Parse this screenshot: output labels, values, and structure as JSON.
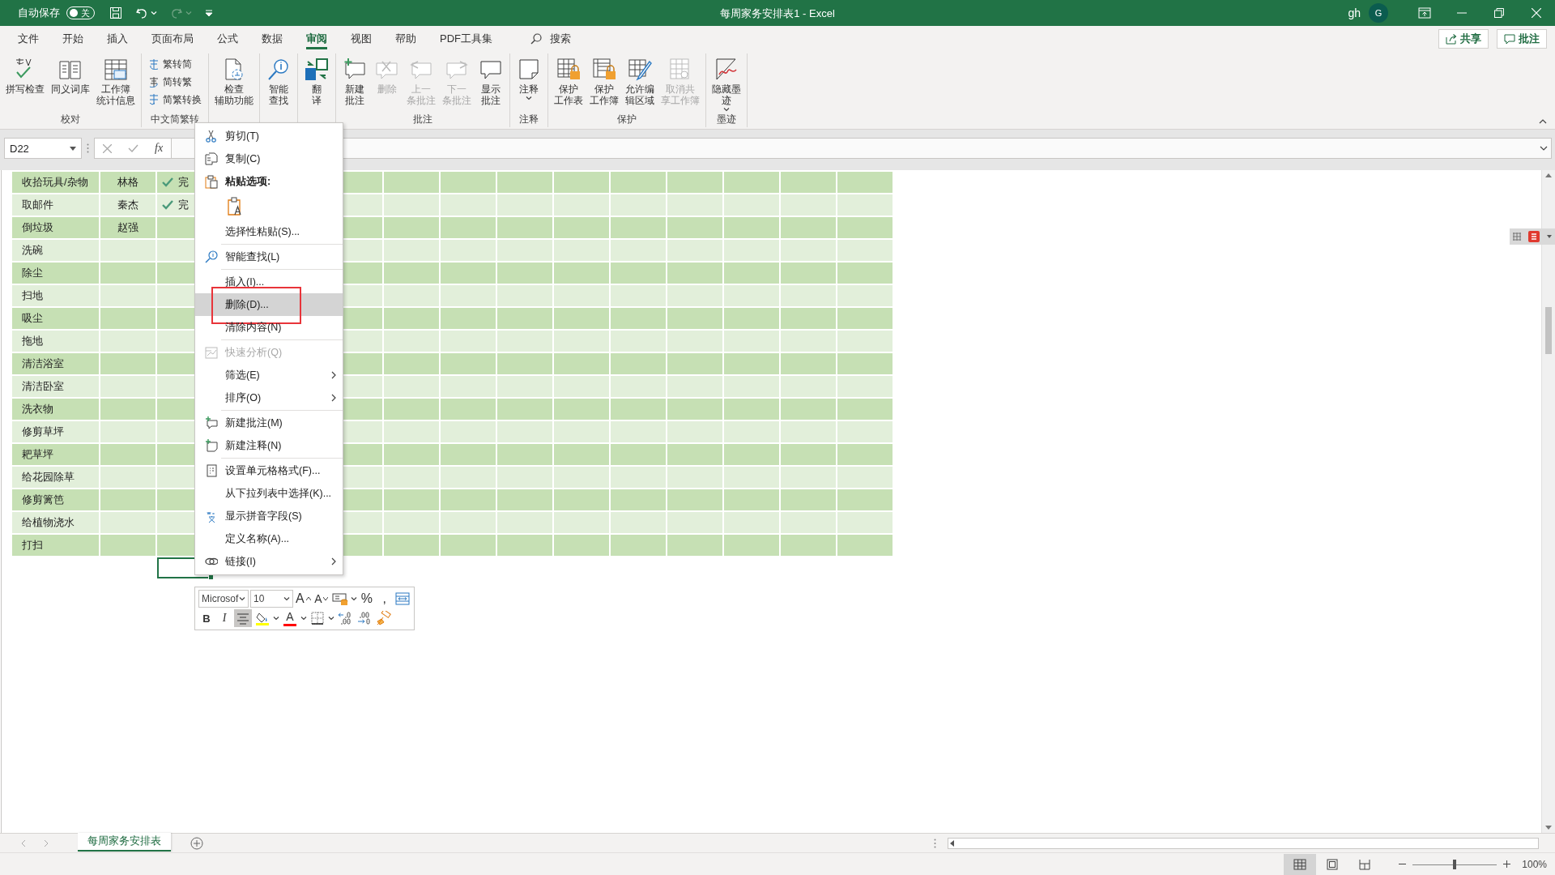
{
  "title_bar": {
    "autosave_label": "自动保存",
    "autosave_on": false,
    "autosave_state": "关",
    "redo_disabled": true,
    "title": "每周家务安排表1  -  Excel",
    "user": "gh",
    "avatar": "G"
  },
  "menu_tabs": [
    {
      "label": "文件",
      "selected": false
    },
    {
      "label": "开始",
      "selected": false
    },
    {
      "label": "插入",
      "selected": false
    },
    {
      "label": "页面布局",
      "selected": false
    },
    {
      "label": "公式",
      "selected": false
    },
    {
      "label": "数据",
      "selected": false
    },
    {
      "label": "审阅",
      "selected": true
    },
    {
      "label": "视图",
      "selected": false
    },
    {
      "label": "帮助",
      "selected": false
    },
    {
      "label": "PDF工具集",
      "selected": false
    }
  ],
  "search": {
    "label": "搜索"
  },
  "top_buttons": [
    {
      "kind": "share",
      "label": "共享"
    },
    {
      "kind": "comments",
      "label": "批注"
    }
  ],
  "ribbon_groups": [
    {
      "label": "校对",
      "kind": "large",
      "buttons": [
        {
          "kind": "spell",
          "lines": [
            "拼写检查"
          ],
          "disabled": false,
          "dropdown": false
        },
        {
          "kind": "thesaurus",
          "lines": [
            "同义词库"
          ],
          "disabled": false,
          "dropdown": false
        },
        {
          "kind": "stats",
          "lines": [
            "工作簿",
            "统计信息"
          ],
          "disabled": false,
          "dropdown": false
        }
      ]
    },
    {
      "label": "中文简繁转",
      "kind": "small",
      "buttons": [
        {
          "kind": "trad2simp",
          "lines": [
            "繁转简"
          ],
          "disabled": false,
          "dropdown": false
        },
        {
          "kind": "simp2trad",
          "lines": [
            "简转繁"
          ],
          "disabled": false,
          "dropdown": false
        },
        {
          "kind": "convert",
          "lines": [
            "简繁转换"
          ],
          "disabled": false,
          "dropdown": false
        }
      ]
    },
    {
      "kind": "large",
      "buttons": [
        {
          "kind": "accessibility",
          "lines": [
            "检查",
            "辅助功能"
          ],
          "disabled": false,
          "dropdown": false
        }
      ]
    },
    {
      "kind": "large",
      "buttons": [
        {
          "kind": "lookup",
          "lines": [
            "智能",
            "查找"
          ],
          "disabled": false,
          "dropdown": false
        }
      ]
    },
    {
      "kind": "large",
      "buttons": [
        {
          "kind": "translate",
          "lines": [
            "翻",
            "译"
          ],
          "disabled": false,
          "dropdown": false
        }
      ]
    },
    {
      "label": "批注",
      "kind": "large",
      "buttons": [
        {
          "kind": "new-comment",
          "lines": [
            "新建",
            "批注"
          ],
          "disabled": false,
          "dropdown": false
        },
        {
          "kind": "delete-comment",
          "lines": [
            "删除"
          ],
          "disabled": true,
          "dropdown": false
        },
        {
          "kind": "prev-comment",
          "lines": [
            "上一",
            "条批注"
          ],
          "disabled": true,
          "dropdown": false
        },
        {
          "kind": "next-comment",
          "lines": [
            "下一",
            "条批注"
          ],
          "disabled": true,
          "dropdown": false
        },
        {
          "kind": "show-comments",
          "lines": [
            "显示",
            "批注"
          ],
          "disabled": false,
          "dropdown": false
        }
      ]
    },
    {
      "label": "注释",
      "kind": "large",
      "buttons": [
        {
          "kind": "notes",
          "lines": [
            "注释"
          ],
          "disabled": false,
          "dropdown": true
        }
      ]
    },
    {
      "label": "保护",
      "kind": "large",
      "buttons": [
        {
          "kind": "protect-sheet",
          "lines": [
            "保护",
            "工作表"
          ],
          "disabled": false,
          "dropdown": false
        },
        {
          "kind": "protect-book",
          "lines": [
            "保护",
            "工作簿"
          ],
          "disabled": false,
          "dropdown": false
        },
        {
          "kind": "allow-edit",
          "lines": [
            "允许编",
            "辑区域"
          ],
          "disabled": false,
          "dropdown": false
        },
        {
          "kind": "unshare",
          "lines": [
            "取消共",
            "享工作簿"
          ],
          "disabled": true,
          "dropdown": false
        }
      ]
    },
    {
      "label": "墨迹",
      "kind": "large",
      "buttons": [
        {
          "kind": "ink",
          "lines": [
            "隐藏墨",
            "迹"
          ],
          "disabled": false,
          "dropdown": true
        }
      ]
    }
  ],
  "formula_bar": {
    "name_box": "D22",
    "function_label": "fx"
  },
  "sheet": {
    "selection_below_last_row": true,
    "rows": [
      {
        "task": "收拾玩具/杂物",
        "person": "林格",
        "done": true,
        "status": "完"
      },
      {
        "task": "取邮件",
        "person": "秦杰",
        "done": true,
        "status": "完"
      },
      {
        "task": "倒垃圾",
        "person": "赵强",
        "done": false
      },
      {
        "task": "洗碗",
        "done": false
      },
      {
        "task": "除尘",
        "done": false
      },
      {
        "task": "扫地",
        "done": false
      },
      {
        "task": "吸尘",
        "done": false
      },
      {
        "task": "拖地",
        "done": false
      },
      {
        "task": "清洁浴室",
        "done": false
      },
      {
        "task": "清洁卧室",
        "done": false
      },
      {
        "task": "洗衣物",
        "done": false
      },
      {
        "task": "修剪草坪",
        "done": false
      },
      {
        "task": "耙草坪",
        "done": false
      },
      {
        "task": "给花园除草",
        "done": false
      },
      {
        "task": "修剪篱笆",
        "done": false
      },
      {
        "task": "给植物浇水",
        "done": false
      },
      {
        "task": "打扫",
        "done": false
      }
    ]
  },
  "context_menu": {
    "items": [
      {
        "kind": "cut",
        "label": "剪切(T)",
        "disabled": false,
        "submenu": false,
        "highlighted": false,
        "framed": false
      },
      {
        "kind": "copy",
        "label": "复制(C)",
        "disabled": false,
        "submenu": false,
        "highlighted": false,
        "framed": false
      },
      {
        "kind": "paste-header",
        "label": "粘贴选项:"
      },
      {
        "kind": "paste-option"
      },
      {
        "kind": "plain",
        "label": "选择性粘贴(S)...",
        "disabled": false,
        "submenu": false,
        "highlighted": false,
        "framed": false
      },
      {
        "kind": "separator"
      },
      {
        "kind": "lookup",
        "label": "智能查找(L)",
        "disabled": false,
        "submenu": false,
        "highlighted": false,
        "framed": false
      },
      {
        "kind": "separator"
      },
      {
        "kind": "plain",
        "label": "插入(I)...",
        "disabled": false,
        "submenu": false,
        "highlighted": false,
        "framed": false
      },
      {
        "kind": "plain",
        "label": "删除(D)...",
        "disabled": false,
        "submenu": false,
        "highlighted": true,
        "framed": true
      },
      {
        "kind": "plain",
        "label": "清除内容(N)",
        "disabled": false,
        "submenu": false,
        "highlighted": false,
        "framed": false
      },
      {
        "kind": "separator"
      },
      {
        "kind": "quick-analysis",
        "label": "快速分析(Q)",
        "disabled": true,
        "submenu": false,
        "highlighted": false,
        "framed": false
      },
      {
        "kind": "plain",
        "label": "筛选(E)",
        "disabled": false,
        "submenu": true,
        "highlighted": false,
        "framed": false
      },
      {
        "kind": "plain",
        "label": "排序(O)",
        "disabled": false,
        "submenu": true,
        "highlighted": false,
        "framed": false
      },
      {
        "kind": "separator"
      },
      {
        "kind": "new-comment",
        "label": "新建批注(M)",
        "disabled": false,
        "submenu": false,
        "highlighted": false,
        "framed": false
      },
      {
        "kind": "new-note",
        "label": "新建注释(N)",
        "disabled": false,
        "submenu": false,
        "highlighted": false,
        "framed": false
      },
      {
        "kind": "separator"
      },
      {
        "kind": "format-cells",
        "label": "设置单元格格式(F)...",
        "disabled": false,
        "submenu": false,
        "highlighted": false,
        "framed": false
      },
      {
        "kind": "plain",
        "label": "从下拉列表中选择(K)...",
        "disabled": false,
        "submenu": false,
        "highlighted": false,
        "framed": false
      },
      {
        "kind": "phonetic",
        "label": "显示拼音字段(S)",
        "disabled": false,
        "submenu": false,
        "highlighted": false,
        "framed": false
      },
      {
        "kind": "plain",
        "label": "定义名称(A)...",
        "disabled": false,
        "submenu": false,
        "highlighted": false,
        "framed": false
      },
      {
        "kind": "link",
        "label": "链接(I)",
        "disabled": false,
        "submenu": true,
        "highlighted": false,
        "framed": false
      }
    ]
  },
  "mini_toolbar": {
    "font": "Microsof",
    "size": "10",
    "rows": [
      [
        {
          "kind": "grow-font",
          "glyph": "A",
          "selected": false
        },
        {
          "kind": "shrink-font",
          "glyph": "A",
          "selected": false
        },
        {
          "kind": "table-style",
          "selected": false
        },
        {
          "kind": "percent",
          "glyph": "%",
          "selected": false
        },
        {
          "kind": "comma",
          "glyph": ",",
          "selected": false
        },
        {
          "kind": "merge",
          "selected": false
        }
      ],
      [
        {
          "kind": "bold",
          "glyph": "B",
          "selected": false
        },
        {
          "kind": "italic",
          "glyph": "I",
          "selected": false
        },
        {
          "kind": "align",
          "selected": true
        },
        {
          "kind": "fill",
          "selected": false
        },
        {
          "kind": "font-color",
          "glyph": "A",
          "selected": false
        },
        {
          "kind": "borders",
          "selected": false
        },
        {
          "kind": "dec-decimal",
          "selected": false
        },
        {
          "kind": "inc-decimal",
          "selected": false
        },
        {
          "kind": "painter",
          "selected": false
        }
      ]
    ]
  },
  "sheet_tabs": [
    {
      "label": "每周家务安排表",
      "selected": true
    }
  ],
  "status_bar": {
    "views": [
      {
        "kind": "normal",
        "selected": true
      },
      {
        "kind": "page-layout",
        "selected": false
      },
      {
        "kind": "page-break",
        "selected": false
      }
    ],
    "zoom": {
      "level": 0.5,
      "reading": "100%"
    }
  }
}
